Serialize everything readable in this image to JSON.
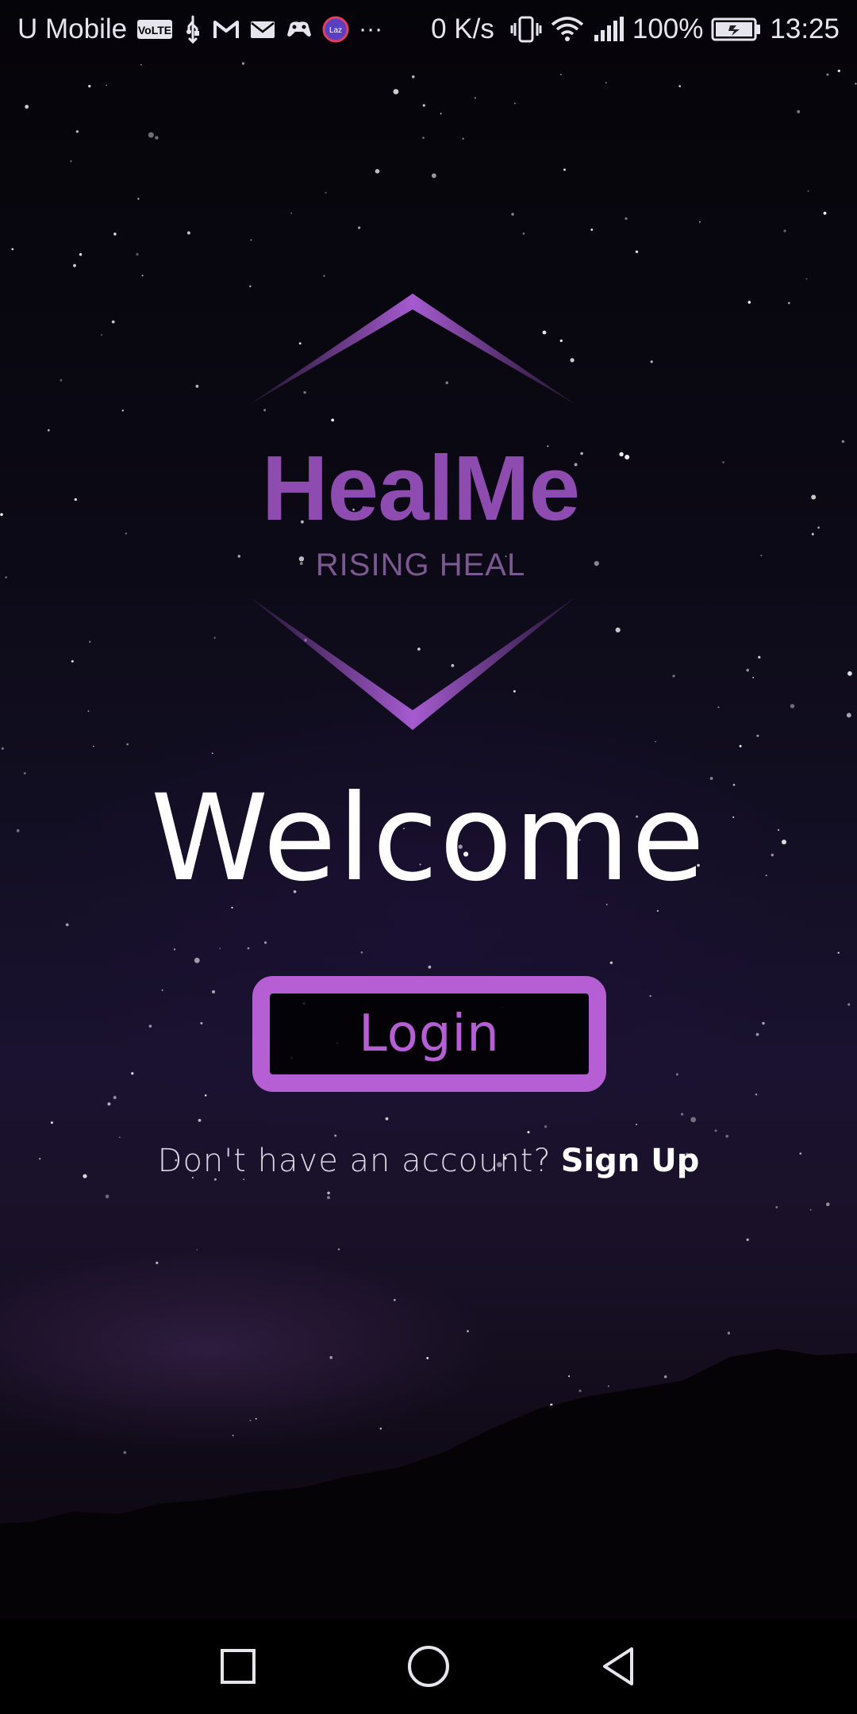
{
  "status_bar": {
    "carrier": "U Mobile",
    "volte_badge": "VoLTE",
    "net_speed": "0 K/s",
    "battery": "100%",
    "time": "13:25",
    "overflow": "···",
    "icons": [
      "volte-icon",
      "usb-icon",
      "gmail-icon",
      "mail-icon",
      "game-icon",
      "lazada-icon",
      "vibrate-icon",
      "wifi-icon",
      "signal-icon",
      "battery-icon"
    ]
  },
  "logo": {
    "title": "HealMe",
    "subtitle": "RISING HEAL",
    "color": "#8e4cb0"
  },
  "welcome": {
    "heading": "Welcome"
  },
  "login": {
    "label": "Login",
    "accent": "#b65fd4"
  },
  "signup": {
    "prompt": "Don't have an account?",
    "link_label": "Sign Up"
  },
  "nav_bar": {
    "buttons": [
      "recent-apps",
      "home",
      "back"
    ]
  }
}
